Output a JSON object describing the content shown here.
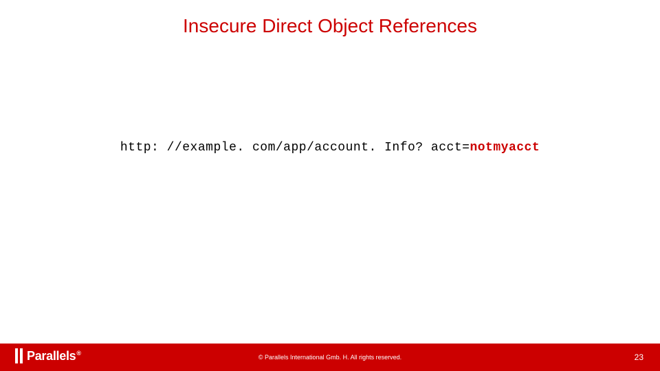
{
  "title": "Insecure Direct Object References",
  "url": {
    "prefix": "http: //example. com/app/account. Info? acct=",
    "highlight": "notmyacct"
  },
  "footer": {
    "logo_text": "Parallels",
    "logo_reg": "®",
    "copyright": "© Parallels International Gmb. H. All rights reserved.",
    "page_number": "23"
  }
}
